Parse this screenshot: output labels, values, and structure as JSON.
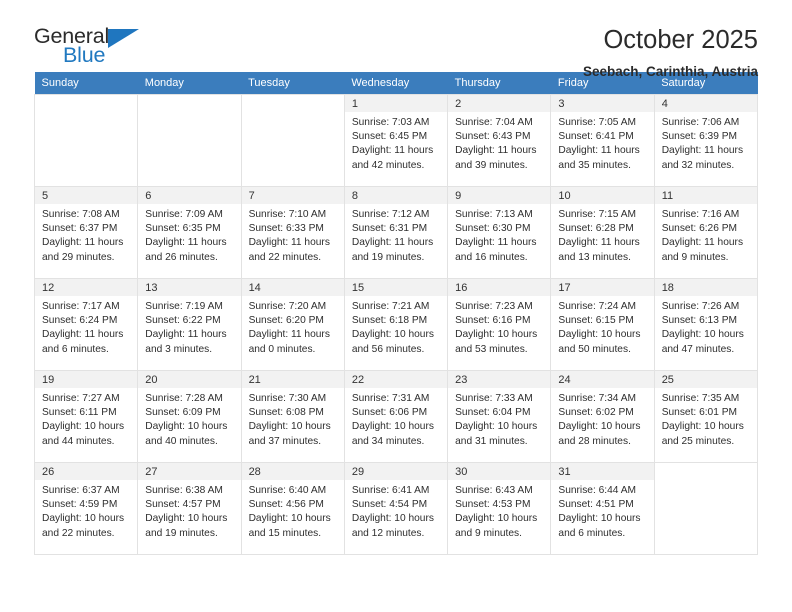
{
  "brand": {
    "name_top": "General",
    "name_bottom": "Blue",
    "triangle_color": "#1f76bf",
    "accent_color": "#3b7dbd"
  },
  "header": {
    "title": "October 2025",
    "subtitle": "Seebach, Carinthia, Austria"
  },
  "calendar": {
    "weekday_headers": [
      "Sunday",
      "Monday",
      "Tuesday",
      "Wednesday",
      "Thursday",
      "Friday",
      "Saturday"
    ],
    "labels": {
      "sunrise": "Sunrise:",
      "sunset": "Sunset:",
      "daylight": "Daylight:"
    },
    "weeks": [
      [
        {
          "day": "",
          "empty": true
        },
        {
          "day": "",
          "empty": true
        },
        {
          "day": "",
          "empty": true
        },
        {
          "day": "1",
          "sunrise": "Sunrise: 7:03 AM",
          "sunset": "Sunset: 6:45 PM",
          "daylight1": "Daylight: 11 hours",
          "daylight2": "and 42 minutes."
        },
        {
          "day": "2",
          "sunrise": "Sunrise: 7:04 AM",
          "sunset": "Sunset: 6:43 PM",
          "daylight1": "Daylight: 11 hours",
          "daylight2": "and 39 minutes."
        },
        {
          "day": "3",
          "sunrise": "Sunrise: 7:05 AM",
          "sunset": "Sunset: 6:41 PM",
          "daylight1": "Daylight: 11 hours",
          "daylight2": "and 35 minutes."
        },
        {
          "day": "4",
          "sunrise": "Sunrise: 7:06 AM",
          "sunset": "Sunset: 6:39 PM",
          "daylight1": "Daylight: 11 hours",
          "daylight2": "and 32 minutes."
        }
      ],
      [
        {
          "day": "5",
          "sunrise": "Sunrise: 7:08 AM",
          "sunset": "Sunset: 6:37 PM",
          "daylight1": "Daylight: 11 hours",
          "daylight2": "and 29 minutes."
        },
        {
          "day": "6",
          "sunrise": "Sunrise: 7:09 AM",
          "sunset": "Sunset: 6:35 PM",
          "daylight1": "Daylight: 11 hours",
          "daylight2": "and 26 minutes."
        },
        {
          "day": "7",
          "sunrise": "Sunrise: 7:10 AM",
          "sunset": "Sunset: 6:33 PM",
          "daylight1": "Daylight: 11 hours",
          "daylight2": "and 22 minutes."
        },
        {
          "day": "8",
          "sunrise": "Sunrise: 7:12 AM",
          "sunset": "Sunset: 6:31 PM",
          "daylight1": "Daylight: 11 hours",
          "daylight2": "and 19 minutes."
        },
        {
          "day": "9",
          "sunrise": "Sunrise: 7:13 AM",
          "sunset": "Sunset: 6:30 PM",
          "daylight1": "Daylight: 11 hours",
          "daylight2": "and 16 minutes."
        },
        {
          "day": "10",
          "sunrise": "Sunrise: 7:15 AM",
          "sunset": "Sunset: 6:28 PM",
          "daylight1": "Daylight: 11 hours",
          "daylight2": "and 13 minutes."
        },
        {
          "day": "11",
          "sunrise": "Sunrise: 7:16 AM",
          "sunset": "Sunset: 6:26 PM",
          "daylight1": "Daylight: 11 hours",
          "daylight2": "and 9 minutes."
        }
      ],
      [
        {
          "day": "12",
          "sunrise": "Sunrise: 7:17 AM",
          "sunset": "Sunset: 6:24 PM",
          "daylight1": "Daylight: 11 hours",
          "daylight2": "and 6 minutes."
        },
        {
          "day": "13",
          "sunrise": "Sunrise: 7:19 AM",
          "sunset": "Sunset: 6:22 PM",
          "daylight1": "Daylight: 11 hours",
          "daylight2": "and 3 minutes."
        },
        {
          "day": "14",
          "sunrise": "Sunrise: 7:20 AM",
          "sunset": "Sunset: 6:20 PM",
          "daylight1": "Daylight: 11 hours",
          "daylight2": "and 0 minutes."
        },
        {
          "day": "15",
          "sunrise": "Sunrise: 7:21 AM",
          "sunset": "Sunset: 6:18 PM",
          "daylight1": "Daylight: 10 hours",
          "daylight2": "and 56 minutes."
        },
        {
          "day": "16",
          "sunrise": "Sunrise: 7:23 AM",
          "sunset": "Sunset: 6:16 PM",
          "daylight1": "Daylight: 10 hours",
          "daylight2": "and 53 minutes."
        },
        {
          "day": "17",
          "sunrise": "Sunrise: 7:24 AM",
          "sunset": "Sunset: 6:15 PM",
          "daylight1": "Daylight: 10 hours",
          "daylight2": "and 50 minutes."
        },
        {
          "day": "18",
          "sunrise": "Sunrise: 7:26 AM",
          "sunset": "Sunset: 6:13 PM",
          "daylight1": "Daylight: 10 hours",
          "daylight2": "and 47 minutes."
        }
      ],
      [
        {
          "day": "19",
          "sunrise": "Sunrise: 7:27 AM",
          "sunset": "Sunset: 6:11 PM",
          "daylight1": "Daylight: 10 hours",
          "daylight2": "and 44 minutes."
        },
        {
          "day": "20",
          "sunrise": "Sunrise: 7:28 AM",
          "sunset": "Sunset: 6:09 PM",
          "daylight1": "Daylight: 10 hours",
          "daylight2": "and 40 minutes."
        },
        {
          "day": "21",
          "sunrise": "Sunrise: 7:30 AM",
          "sunset": "Sunset: 6:08 PM",
          "daylight1": "Daylight: 10 hours",
          "daylight2": "and 37 minutes."
        },
        {
          "day": "22",
          "sunrise": "Sunrise: 7:31 AM",
          "sunset": "Sunset: 6:06 PM",
          "daylight1": "Daylight: 10 hours",
          "daylight2": "and 34 minutes."
        },
        {
          "day": "23",
          "sunrise": "Sunrise: 7:33 AM",
          "sunset": "Sunset: 6:04 PM",
          "daylight1": "Daylight: 10 hours",
          "daylight2": "and 31 minutes."
        },
        {
          "day": "24",
          "sunrise": "Sunrise: 7:34 AM",
          "sunset": "Sunset: 6:02 PM",
          "daylight1": "Daylight: 10 hours",
          "daylight2": "and 28 minutes."
        },
        {
          "day": "25",
          "sunrise": "Sunrise: 7:35 AM",
          "sunset": "Sunset: 6:01 PM",
          "daylight1": "Daylight: 10 hours",
          "daylight2": "and 25 minutes."
        }
      ],
      [
        {
          "day": "26",
          "sunrise": "Sunrise: 6:37 AM",
          "sunset": "Sunset: 4:59 PM",
          "daylight1": "Daylight: 10 hours",
          "daylight2": "and 22 minutes."
        },
        {
          "day": "27",
          "sunrise": "Sunrise: 6:38 AM",
          "sunset": "Sunset: 4:57 PM",
          "daylight1": "Daylight: 10 hours",
          "daylight2": "and 19 minutes."
        },
        {
          "day": "28",
          "sunrise": "Sunrise: 6:40 AM",
          "sunset": "Sunset: 4:56 PM",
          "daylight1": "Daylight: 10 hours",
          "daylight2": "and 15 minutes."
        },
        {
          "day": "29",
          "sunrise": "Sunrise: 6:41 AM",
          "sunset": "Sunset: 4:54 PM",
          "daylight1": "Daylight: 10 hours",
          "daylight2": "and 12 minutes."
        },
        {
          "day": "30",
          "sunrise": "Sunrise: 6:43 AM",
          "sunset": "Sunset: 4:53 PM",
          "daylight1": "Daylight: 10 hours",
          "daylight2": "and 9 minutes."
        },
        {
          "day": "31",
          "sunrise": "Sunrise: 6:44 AM",
          "sunset": "Sunset: 4:51 PM",
          "daylight1": "Daylight: 10 hours",
          "daylight2": "and 6 minutes."
        },
        {
          "day": "",
          "empty": true
        }
      ]
    ]
  }
}
